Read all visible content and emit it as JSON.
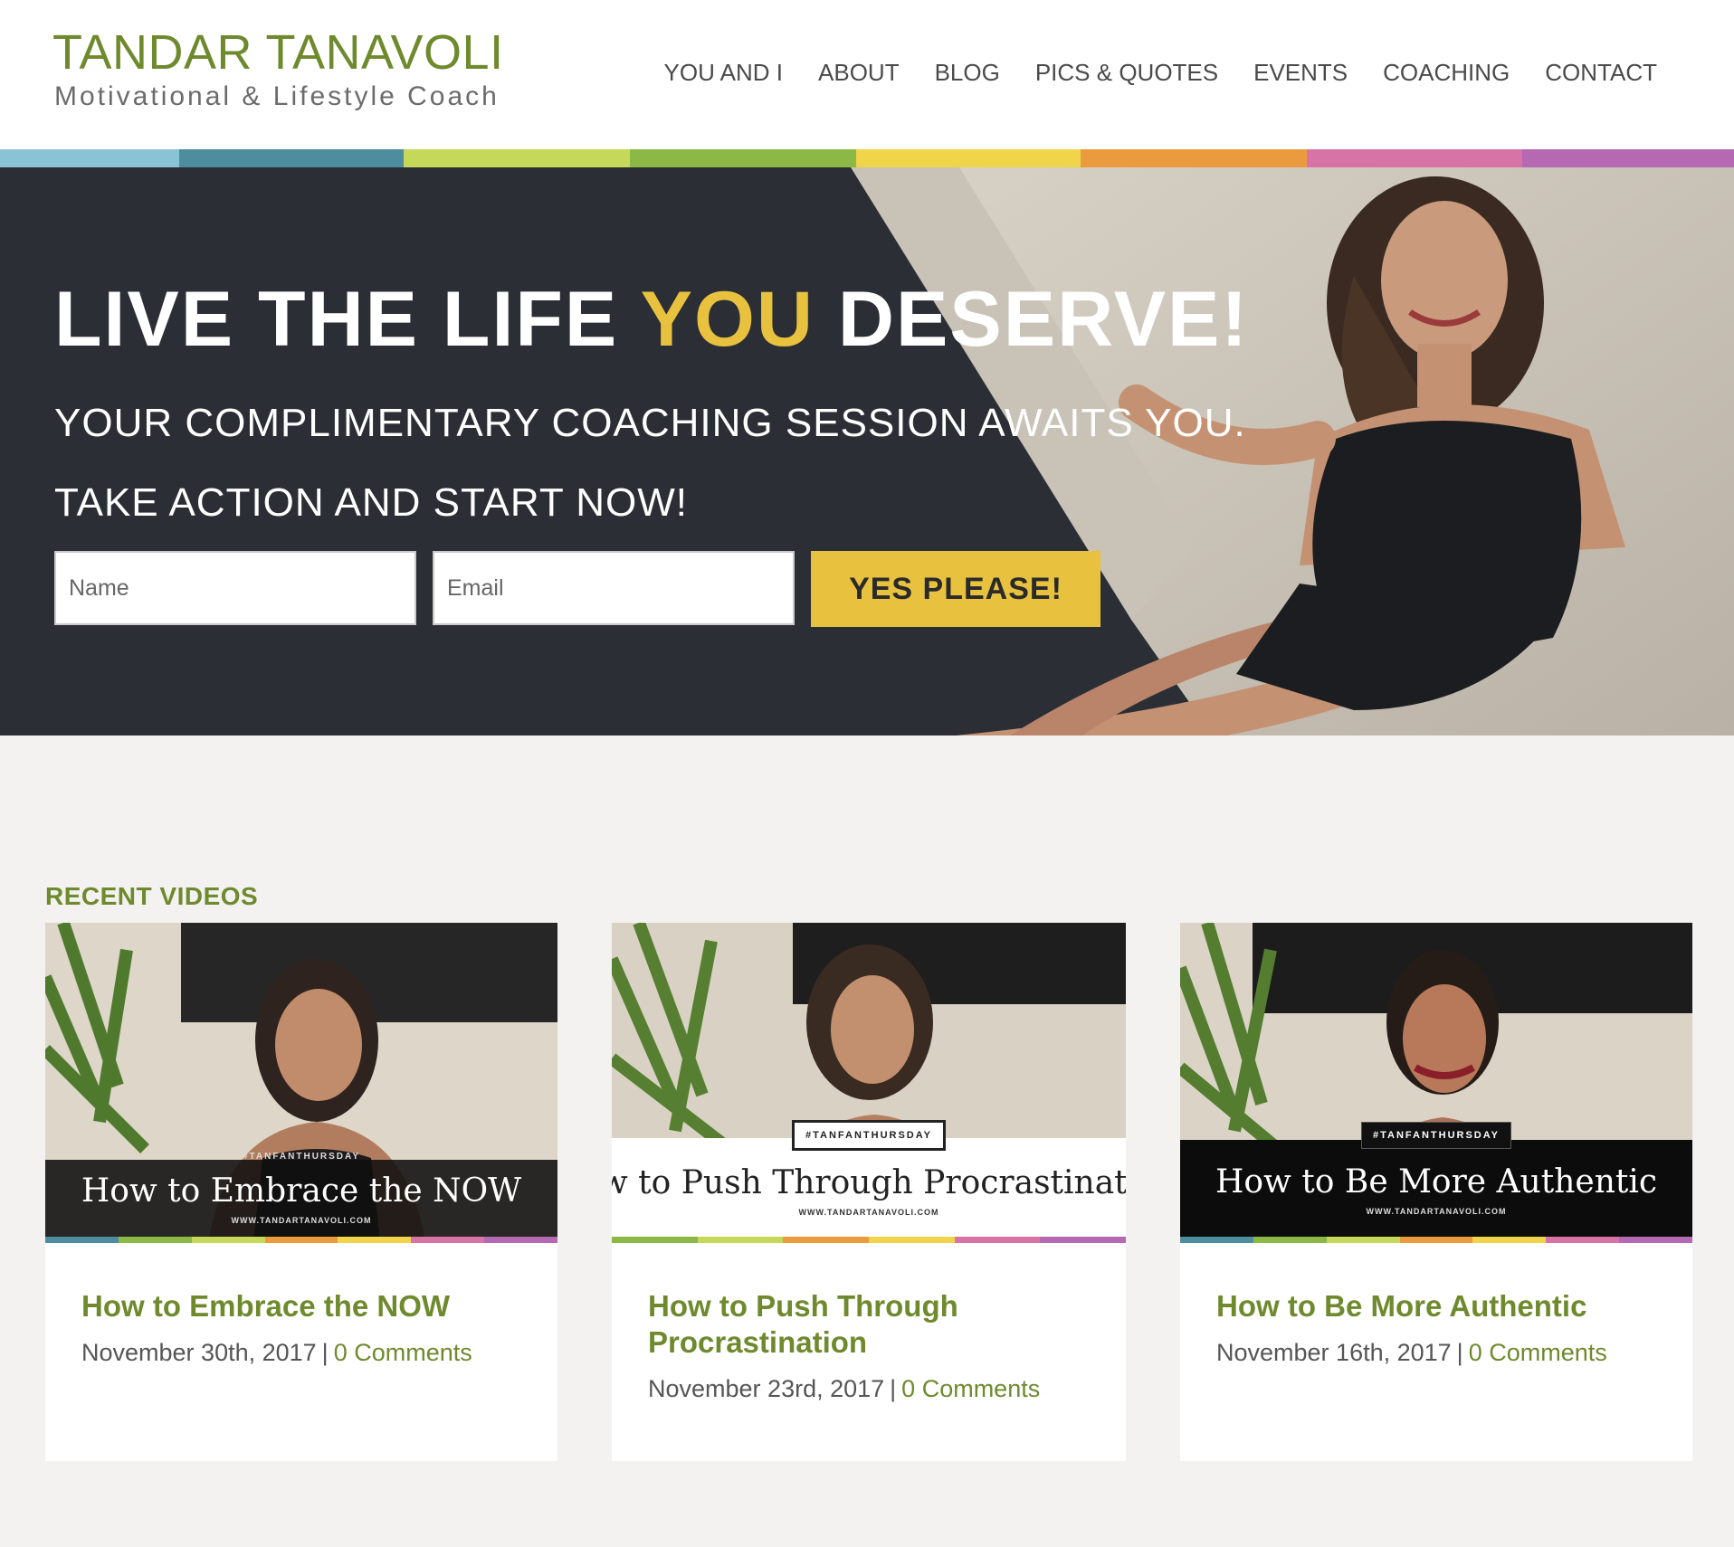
{
  "site": {
    "name": "TANDAR TANAVOLI",
    "tagline": "Motivational & Lifestyle Coach"
  },
  "nav": [
    {
      "label": "YOU AND I"
    },
    {
      "label": "ABOUT"
    },
    {
      "label": "BLOG"
    },
    {
      "label": "PICS & QUOTES"
    },
    {
      "label": "EVENTS"
    },
    {
      "label": "COACHING"
    },
    {
      "label": "CONTACT"
    }
  ],
  "brand_colors": {
    "green": "#6e8a2d",
    "yellow": "#e8c23f",
    "strip": [
      "#8bc3d6",
      "#4e8d9e",
      "#c6d85a",
      "#8cb846",
      "#f0d54b",
      "#ec9a3e",
      "#d873a8",
      "#b569b3"
    ]
  },
  "hero": {
    "headline_part1": "LIVE THE LIFE",
    "headline_accent": "YOU",
    "headline_part2": "DESERVE!",
    "subline1": "YOUR COMPLIMENTARY COACHING SESSION AWAITS YOU.",
    "subline2": "TAKE ACTION AND START NOW!",
    "form": {
      "name_placeholder": "Name",
      "email_placeholder": "Email",
      "submit_label": "YES PLEASE!"
    }
  },
  "recent_videos": {
    "section_title": "RECENT VIDEOS",
    "items": [
      {
        "title": "How to Embrace the NOW",
        "date": "November 30th, 2017",
        "separator": "|",
        "comments": "0 Comments",
        "thumb_tag": "#TANFANTHURSDAY",
        "thumb_title": "How to Embrace the NOW",
        "thumb_url": "WWW.TANDARTANAVOLI.COM"
      },
      {
        "title": "How to Push Through Procrastination",
        "date": "November 23rd, 2017",
        "separator": "|",
        "comments": "0 Comments",
        "thumb_tag": "#TANFANTHURSDAY",
        "thumb_title": "ow to Push Through Procrastinatio",
        "thumb_url": "WWW.TANDARTANAVOLI.COM"
      },
      {
        "title": "How to Be More Authentic",
        "date": "November 16th, 2017",
        "separator": "|",
        "comments": "0 Comments",
        "thumb_tag": "#TANFANTHURSDAY",
        "thumb_title": "How to Be More Authentic",
        "thumb_url": "WWW.TANDARTANAVOLI.COM"
      }
    ]
  }
}
